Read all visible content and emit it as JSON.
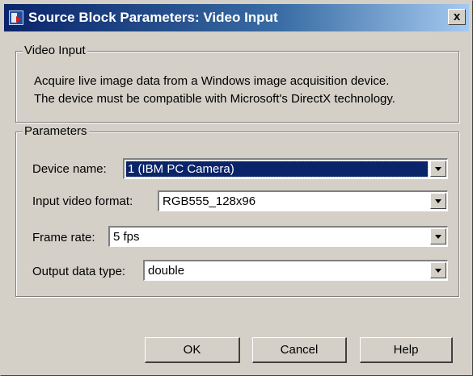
{
  "window": {
    "title": "Source Block Parameters: Video Input",
    "close_label": "x"
  },
  "video_input_group": {
    "label": "Video Input",
    "description_line1": "Acquire live image data from a Windows image acquisition device.",
    "description_line2": "The device must be compatible with Microsoft's DirectX technology."
  },
  "parameters_group": {
    "label": "Parameters",
    "fields": [
      {
        "label": "Device name:",
        "value": "1 (IBM PC Camera)"
      },
      {
        "label": "Input video format:",
        "value": "RGB555_128x96"
      },
      {
        "label": "Frame rate:",
        "value": "5 fps"
      },
      {
        "label": "Output data type:",
        "value": "double"
      }
    ]
  },
  "buttons": {
    "ok": "OK",
    "cancel": "Cancel",
    "help": "Help"
  },
  "icons": {
    "title_icon": "simulink-block-icon",
    "dropdown": "chevron-down-icon"
  }
}
